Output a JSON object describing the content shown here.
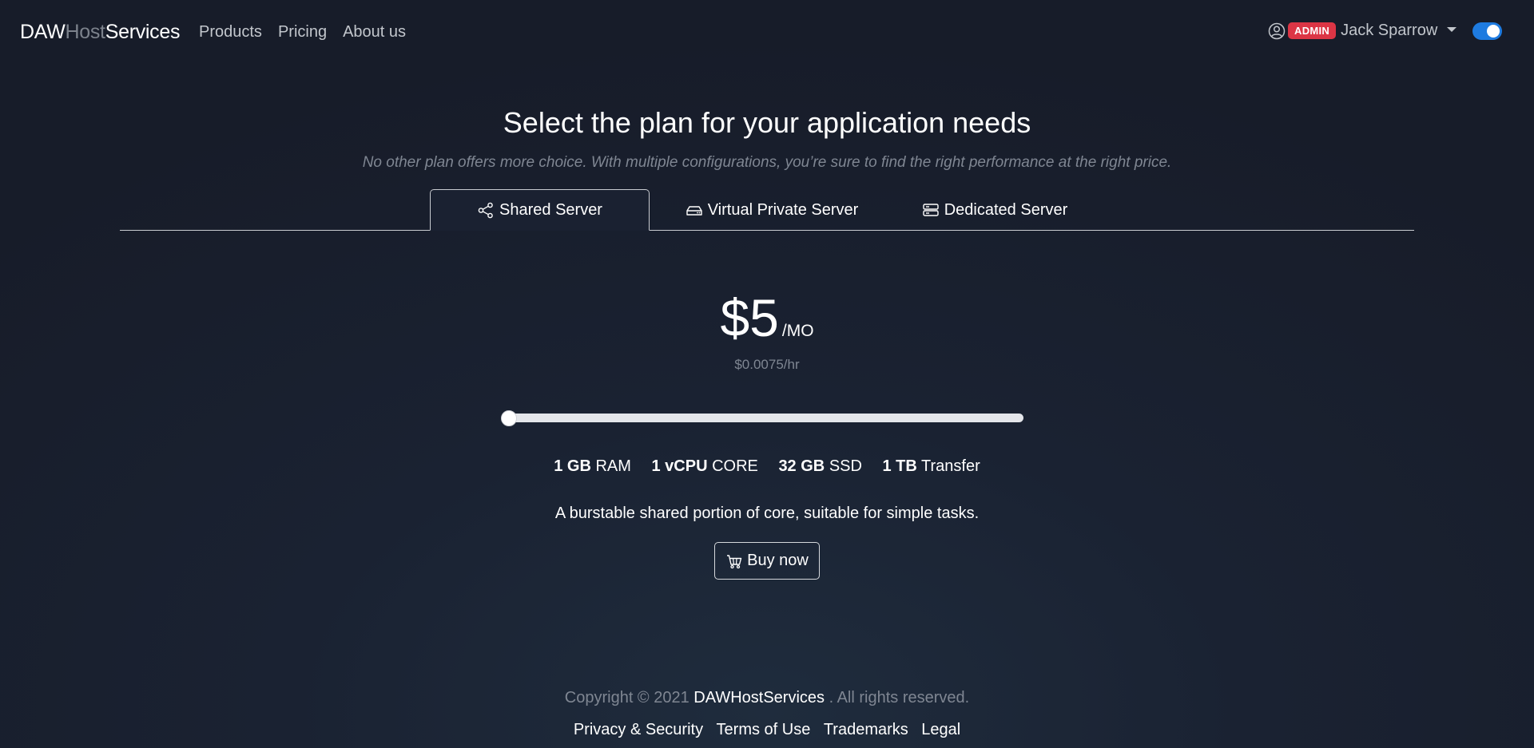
{
  "navbar": {
    "brand": {
      "part1": "DAW",
      "part2": "Host",
      "part3": "Services"
    },
    "links": [
      "Products",
      "Pricing",
      "About us"
    ],
    "user": {
      "badge": "ADMIN",
      "name": "Jack Sparrow"
    },
    "theme_toggle_on": true
  },
  "header": {
    "title": "Select the plan for your application needs",
    "subtitle": "No other plan offers more choice. With multiple configurations, you’re sure to find the right performance at the right price."
  },
  "tabs": [
    {
      "label": "Shared Server",
      "icon": "share-icon",
      "active": true
    },
    {
      "label": "Virtual Private Server",
      "icon": "hdd-icon",
      "active": false
    },
    {
      "label": "Dedicated Server",
      "icon": "server-icon",
      "active": false
    }
  ],
  "plan": {
    "price": "$5",
    "period": "/MO",
    "hourly": "$0.0075/hr",
    "slider_position": 0,
    "specs": [
      {
        "value": "1 GB",
        "unit": "RAM"
      },
      {
        "value": "1 vCPU",
        "unit": "CORE"
      },
      {
        "value": "32 GB",
        "unit": "SSD"
      },
      {
        "value": "1 TB",
        "unit": "Transfer"
      }
    ],
    "description": "A burstable shared portion of core, suitable for simple tasks.",
    "buy_label": "Buy now"
  },
  "footer": {
    "copyright_prefix": "Copyright © 2021",
    "copyright_brand": "DAWHostServices",
    "copyright_suffix": ". All rights reserved.",
    "links": [
      "Privacy & Security",
      "Terms of Use",
      "Trademarks",
      "Legal"
    ]
  },
  "colors": {
    "accent": "#1e7be0",
    "badge": "#dc3545",
    "muted": "#7f8692"
  }
}
